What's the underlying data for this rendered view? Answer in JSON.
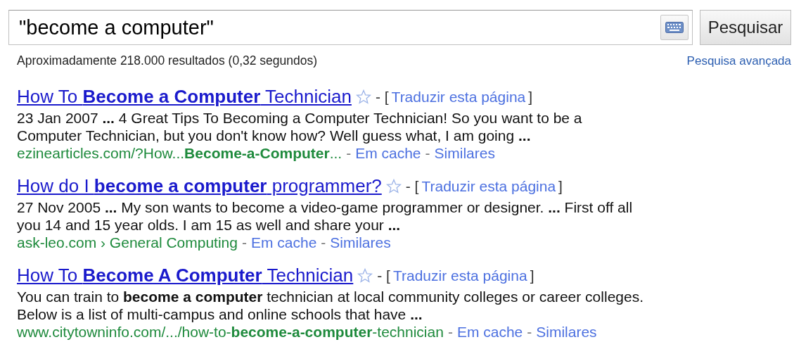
{
  "search": {
    "value": "\"become a computer\"",
    "button": "Pesquisar"
  },
  "stats": "Aproximadamente 218.000 resultados (0,32 segundos)",
  "advanced_link": "Pesquisa avançada",
  "results": [
    {
      "title": "How To **Become a Computer** Technician",
      "translate_open": "- [",
      "translate": "Traduzir esta página",
      "translate_close": "]",
      "snippet": "23 Jan 2007 **...** 4 Great Tips To Becoming a Computer Technician! So you want to be a Computer Technician, but you don't know how? Well guess what, I am going **...**",
      "url": "ezinearticles.com/?How...**Become-a-Computer**...",
      "actions": [
        {
          "sep": "-",
          "label": "Em cache"
        },
        {
          "sep": "-",
          "label": "Similares"
        }
      ]
    },
    {
      "title": "How do I **become a computer** programmer?",
      "translate_open": "- [",
      "translate": "Traduzir esta página",
      "translate_close": "]",
      "snippet": "27 Nov 2005 **...** My son wants to become a video-game programmer or designer. **...** First off all you 14 and 15 year olds. I am 15 as well and share your **...**",
      "url": "ask-leo.com › General Computing",
      "actions": [
        {
          "sep": "-",
          "label": "Em cache"
        },
        {
          "sep": "-",
          "label": "Similares"
        }
      ]
    },
    {
      "title": "How To **Become A Computer** Technician",
      "translate_open": "- [",
      "translate": "Traduzir esta página",
      "translate_close": "]",
      "snippet": "You can train to **become a computer** technician at local community colleges or career colleges. Below is a list of multi-campus and online schools that have **...**",
      "url": "www.citytowninfo.com/.../how-to-**become-a-computer**-technician",
      "actions": [
        {
          "sep": "-",
          "label": "Em cache"
        },
        {
          "sep": "-",
          "label": "Similares"
        }
      ]
    }
  ]
}
